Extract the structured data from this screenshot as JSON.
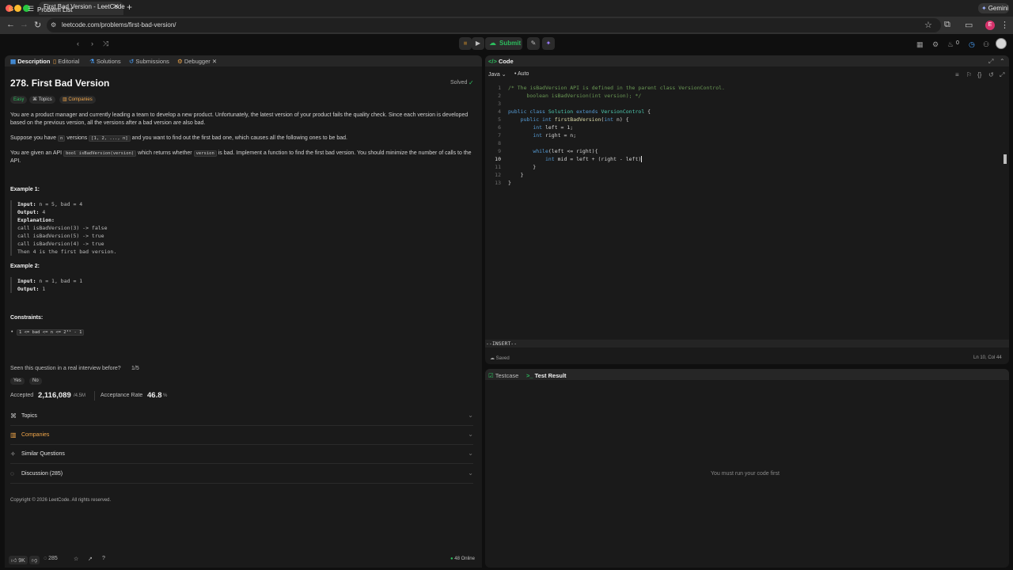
{
  "browser": {
    "tab_title": "First Bad Version - LeetCode",
    "tab_close": "✕",
    "new_tab": "+",
    "url": "leetcode.com/problems/first-bad-version/",
    "gemini_label": "Gemini",
    "profile_initial": "E"
  },
  "topbar": {
    "problem_list": "Problem List",
    "submit_label": "Submit",
    "streak_count": "0"
  },
  "left_tabs": [
    "Description",
    "Editorial",
    "Solutions",
    "Submissions",
    "Debugger"
  ],
  "problem": {
    "title": "278. First Bad Version",
    "solved_label": "Solved",
    "difficulty": "Easy",
    "topics_chip": "Topics",
    "companies_chip": "Companies",
    "para1": "You are a product manager and currently leading a team to develop a new product. Unfortunately, the latest version of your product fails the quality check. Since each version is developed based on the previous version, all the versions after a bad version are also bad.",
    "para2_a": "Suppose you have",
    "para2_n": "n",
    "para2_b": "versions",
    "para2_list": "[1, 2, ..., n]",
    "para2_c": "and you want to find out the first bad one, which causes all the following ones to be bad.",
    "para3_a": "You are given an API",
    "para3_api": "bool isBadVersion(version)",
    "para3_b": "which returns whether",
    "para3_ver": "version",
    "para3_c": "is bad. Implement a function to find the first bad version. You should minimize the number of calls to the API.",
    "example1_title": "Example 1:",
    "example1": {
      "input_label": "Input:",
      "input": "n = 5, bad = 4",
      "output_label": "Output:",
      "output": "4",
      "expl_label": "Explanation:",
      "lines": [
        "call isBadVersion(3) -> false",
        "call isBadVersion(5) -> true",
        "call isBadVersion(4) -> true",
        "Then 4 is the first bad version."
      ]
    },
    "example2_title": "Example 2:",
    "example2": {
      "input_label": "Input:",
      "input": "n = 1, bad = 1",
      "output_label": "Output:",
      "output": "1"
    },
    "constraints_title": "Constraints:",
    "constraint1": "1 <= bad <= n <= 2³¹ - 1",
    "interview_q": "Seen this question in a real interview before?",
    "interview_page": "1/5",
    "yes": "Yes",
    "no": "No",
    "accepted_label": "Accepted",
    "accepted_value": "2,116,089",
    "accepted_total": "/4.5M",
    "rate_label": "Acceptance Rate",
    "rate_value": "46.8",
    "rate_unit": "%",
    "sections": [
      "Topics",
      "Companies",
      "Similar Questions",
      "Discussion (285)"
    ],
    "copyright": "Copyright © 2026 LeetCode. All rights reserved."
  },
  "bottom": {
    "likes": "9K",
    "comments": "285",
    "online": "48 Online"
  },
  "code_panel": {
    "title": "Code",
    "language": "Java",
    "mode": "Auto",
    "lines": [
      "1",
      "2",
      "3",
      "4",
      "5",
      "6",
      "7",
      "8",
      "9",
      "10",
      "11",
      "12",
      "13"
    ],
    "insert_mode": "--INSERT--",
    "saved": "Saved",
    "cursor_pos": "Ln 10, Col 44"
  },
  "result_panel": {
    "tab_testcase": "Testcase",
    "tab_result": "Test Result",
    "message": "You must run your code first"
  },
  "colors": {
    "accent_green": "#2cbb5d",
    "brand_orange": "#f0a64a",
    "bg": "#0f0f0f",
    "panel": "#1a1a1a"
  }
}
